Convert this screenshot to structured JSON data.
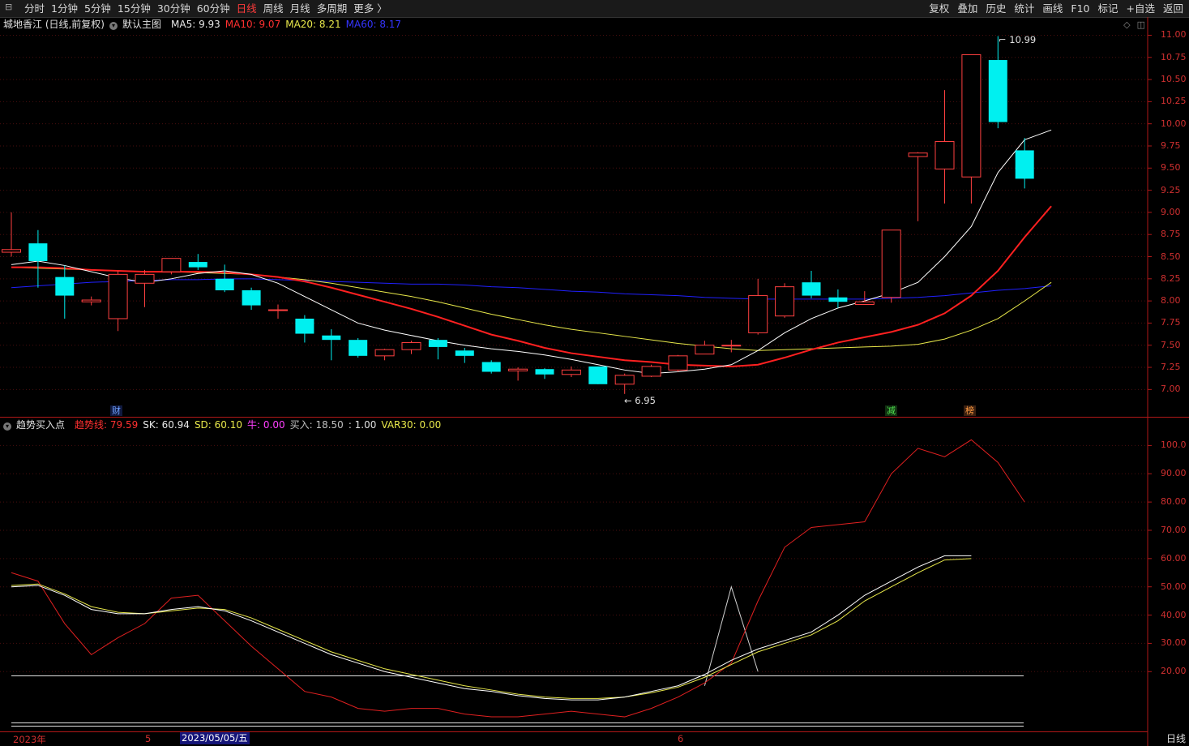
{
  "toolbar": {
    "periods": [
      "分时",
      "1分钟",
      "5分钟",
      "15分钟",
      "30分钟",
      "60分钟",
      "日线",
      "周线",
      "月线",
      "多周期",
      "更多 〉"
    ],
    "active_period": "日线",
    "tools": [
      "复权",
      "叠加",
      "历史",
      "统计",
      "画线",
      "F10",
      "标记",
      "+自选",
      "返回"
    ]
  },
  "main_legend": {
    "stock": "城地香江 (日线,前复权)",
    "template": "默认主图",
    "ma5": "MA5: 9.93",
    "ma10": "MA10: 9.07",
    "ma20": "MA20: 8.21",
    "ma60": "MA60: 8.17",
    "colors": {
      "ma5": "#ffffff",
      "ma10": "#ff2020",
      "ma20": "#e8e84a",
      "ma60": "#2424ff"
    }
  },
  "indicator_legend": {
    "name": "趋势买入点",
    "trend": "趋势线: 79.59",
    "sk": "SK: 60.94",
    "sd": "SD: 60.10",
    "niu": "牛: 0.00",
    "buy": "买入: 18.50",
    "blank": ": 1.00",
    "var30": "VAR30: 0.00"
  },
  "price_axis": [
    "11.00",
    "10.75",
    "10.50",
    "10.25",
    "10.00",
    "9.75",
    "9.50",
    "9.25",
    "9.00",
    "8.75",
    "8.50",
    "8.25",
    "8.00",
    "7.75",
    "7.50",
    "7.25",
    "7.00"
  ],
  "indicator_axis": [
    "100.0",
    "90.00",
    "80.00",
    "70.00",
    "60.00",
    "50.00",
    "40.00",
    "30.00",
    "20.00"
  ],
  "annotations": {
    "high": "10.99",
    "low": "6.95"
  },
  "events": [
    {
      "label": "财",
      "color": "#6fa0ff",
      "bg": "#101a40"
    },
    {
      "label": "减",
      "color": "#50e050",
      "bg": "#103010"
    },
    {
      "label": "榜",
      "color": "#ff9a40",
      "bg": "#3a2010"
    }
  ],
  "date_axis": {
    "year": "2023年",
    "m5": "5",
    "m6": "6",
    "cursor": "2023/05/05/五"
  },
  "period_label": "日线",
  "chart_data": {
    "type": "candlestick",
    "ylim": [
      6.82,
      11.05
    ],
    "candles": [
      {
        "o": 8.55,
        "c": 8.58,
        "h": 9.0,
        "l": 8.5
      },
      {
        "o": 8.65,
        "c": 8.45,
        "h": 8.8,
        "l": 8.15
      },
      {
        "o": 8.27,
        "c": 8.06,
        "h": 8.4,
        "l": 7.8
      },
      {
        "o": 7.99,
        "c": 8.01,
        "h": 8.05,
        "l": 7.95
      },
      {
        "o": 7.8,
        "c": 8.3,
        "h": 8.34,
        "l": 7.66
      },
      {
        "o": 8.2,
        "c": 8.3,
        "h": 8.35,
        "l": 7.93
      },
      {
        "o": 8.33,
        "c": 8.48,
        "h": 8.48,
        "l": 8.3
      },
      {
        "o": 8.44,
        "c": 8.38,
        "h": 8.53,
        "l": 8.35
      },
      {
        "o": 8.25,
        "c": 8.12,
        "h": 8.41,
        "l": 8.1
      },
      {
        "o": 8.12,
        "c": 7.95,
        "h": 8.15,
        "l": 7.9
      },
      {
        "o": 7.9,
        "c": 7.9,
        "h": 7.96,
        "l": 7.8
      },
      {
        "o": 7.8,
        "c": 7.63,
        "h": 7.84,
        "l": 7.53
      },
      {
        "o": 7.61,
        "c": 7.56,
        "h": 7.68,
        "l": 7.33
      },
      {
        "o": 7.56,
        "c": 7.38,
        "h": 7.58,
        "l": 7.36
      },
      {
        "o": 7.38,
        "c": 7.45,
        "h": 7.46,
        "l": 7.33
      },
      {
        "o": 7.45,
        "c": 7.53,
        "h": 7.55,
        "l": 7.4
      },
      {
        "o": 7.56,
        "c": 7.48,
        "h": 7.58,
        "l": 7.34
      },
      {
        "o": 7.44,
        "c": 7.38,
        "h": 7.47,
        "l": 7.3
      },
      {
        "o": 7.31,
        "c": 7.2,
        "h": 7.33,
        "l": 7.18
      },
      {
        "o": 7.21,
        "c": 7.23,
        "h": 7.25,
        "l": 7.1
      },
      {
        "o": 7.23,
        "c": 7.17,
        "h": 7.24,
        "l": 7.12
      },
      {
        "o": 7.17,
        "c": 7.22,
        "h": 7.26,
        "l": 7.14
      },
      {
        "o": 7.26,
        "c": 7.06,
        "h": 7.26,
        "l": 7.06
      },
      {
        "o": 7.06,
        "c": 7.16,
        "h": 7.18,
        "l": 6.95
      },
      {
        "o": 7.15,
        "c": 7.26,
        "h": 7.28,
        "l": 7.14
      },
      {
        "o": 7.22,
        "c": 7.38,
        "h": 7.39,
        "l": 7.2
      },
      {
        "o": 7.4,
        "c": 7.5,
        "h": 7.55,
        "l": 7.4
      },
      {
        "o": 7.5,
        "c": 7.5,
        "h": 7.56,
        "l": 7.42
      },
      {
        "o": 7.64,
        "c": 8.06,
        "h": 8.25,
        "l": 7.62
      },
      {
        "o": 7.83,
        "c": 8.16,
        "h": 8.2,
        "l": 7.81
      },
      {
        "o": 8.21,
        "c": 8.06,
        "h": 8.34,
        "l": 8.03
      },
      {
        "o": 8.04,
        "c": 7.99,
        "h": 8.13,
        "l": 7.92
      },
      {
        "o": 7.96,
        "c": 7.99,
        "h": 8.11,
        "l": 7.98
      },
      {
        "o": 8.04,
        "c": 8.8,
        "h": 8.8,
        "l": 7.98
      },
      {
        "o": 9.63,
        "c": 9.67,
        "h": 9.68,
        "l": 8.9
      },
      {
        "o": 9.49,
        "c": 9.8,
        "h": 10.38,
        "l": 9.1
      },
      {
        "o": 9.4,
        "c": 10.78,
        "h": 10.78,
        "l": 9.1
      },
      {
        "o": 10.72,
        "c": 10.02,
        "h": 10.99,
        "l": 9.95
      },
      {
        "o": 9.7,
        "c": 9.38,
        "h": 9.84,
        "l": 9.27
      }
    ],
    "ma5": [
      8.41,
      8.45,
      8.4,
      8.33,
      8.26,
      8.21,
      8.25,
      8.31,
      8.34,
      8.3,
      8.2,
      8.05,
      7.9,
      7.75,
      7.67,
      7.61,
      7.55,
      7.5,
      7.46,
      7.43,
      7.39,
      7.34,
      7.28,
      7.22,
      7.18,
      7.2,
      7.23,
      7.28,
      7.44,
      7.64,
      7.8,
      7.92,
      8.0,
      8.09,
      8.21,
      8.5,
      8.84,
      9.45,
      9.82,
      9.93
    ],
    "ma10": [
      8.38,
      8.38,
      8.37,
      8.35,
      8.34,
      8.33,
      8.33,
      8.33,
      8.32,
      8.3,
      8.27,
      8.22,
      8.15,
      8.07,
      7.99,
      7.91,
      7.82,
      7.72,
      7.62,
      7.55,
      7.47,
      7.41,
      7.37,
      7.33,
      7.31,
      7.28,
      7.27,
      7.26,
      7.28,
      7.36,
      7.45,
      7.53,
      7.59,
      7.65,
      7.73,
      7.86,
      8.06,
      8.34,
      8.72,
      9.07
    ],
    "ma20": [
      8.38,
      8.37,
      8.36,
      8.35,
      8.34,
      8.33,
      8.33,
      8.32,
      8.31,
      8.3,
      8.27,
      8.24,
      8.2,
      8.15,
      8.1,
      8.05,
      7.99,
      7.92,
      7.85,
      7.79,
      7.73,
      7.68,
      7.64,
      7.6,
      7.56,
      7.52,
      7.49,
      7.46,
      7.44,
      7.45,
      7.46,
      7.47,
      7.48,
      7.49,
      7.51,
      7.57,
      7.67,
      7.8,
      8.0,
      8.21
    ],
    "ma60": [
      8.15,
      8.17,
      8.19,
      8.21,
      8.22,
      8.23,
      8.24,
      8.24,
      8.25,
      8.25,
      8.24,
      8.23,
      8.22,
      8.21,
      8.2,
      8.19,
      8.19,
      8.18,
      8.16,
      8.15,
      8.13,
      8.11,
      8.1,
      8.08,
      8.07,
      8.06,
      8.04,
      8.03,
      8.02,
      8.02,
      8.02,
      8.02,
      8.02,
      8.03,
      8.04,
      8.06,
      8.09,
      8.12,
      8.14,
      8.17
    ],
    "indicator": {
      "ylim": [
        0,
        107
      ],
      "trend": [
        55,
        52,
        37,
        26,
        32,
        37,
        46,
        47,
        38,
        29,
        21,
        13,
        11,
        7,
        6,
        7,
        7,
        5,
        4,
        4,
        5,
        6,
        5,
        4,
        7,
        11,
        16,
        23,
        45,
        64,
        71,
        72,
        73,
        90,
        99,
        96,
        102,
        94,
        80
      ],
      "sk": [
        50,
        50.5,
        47,
        42,
        40.5,
        40.5,
        42,
        43,
        41.5,
        38,
        34,
        30,
        26,
        23,
        20,
        18,
        16,
        14,
        13,
        11.5,
        10.5,
        10,
        10,
        11,
        13,
        15,
        19,
        24,
        28,
        31,
        34,
        40,
        47,
        52,
        57,
        61,
        61
      ],
      "sd": [
        50.5,
        51,
        47.5,
        43,
        41,
        40.5,
        41.5,
        42.5,
        42,
        39,
        35,
        31,
        27,
        24,
        21,
        19,
        17,
        15,
        13.5,
        12,
        11,
        10.5,
        10.5,
        11,
        12.5,
        14.5,
        18,
        22.5,
        27,
        30,
        33,
        38,
        45,
        50,
        55,
        59.5,
        60
      ],
      "extra": [
        50,
        20,
        15,
        0
      ],
      "levels": [
        18.5,
        1
      ]
    }
  }
}
